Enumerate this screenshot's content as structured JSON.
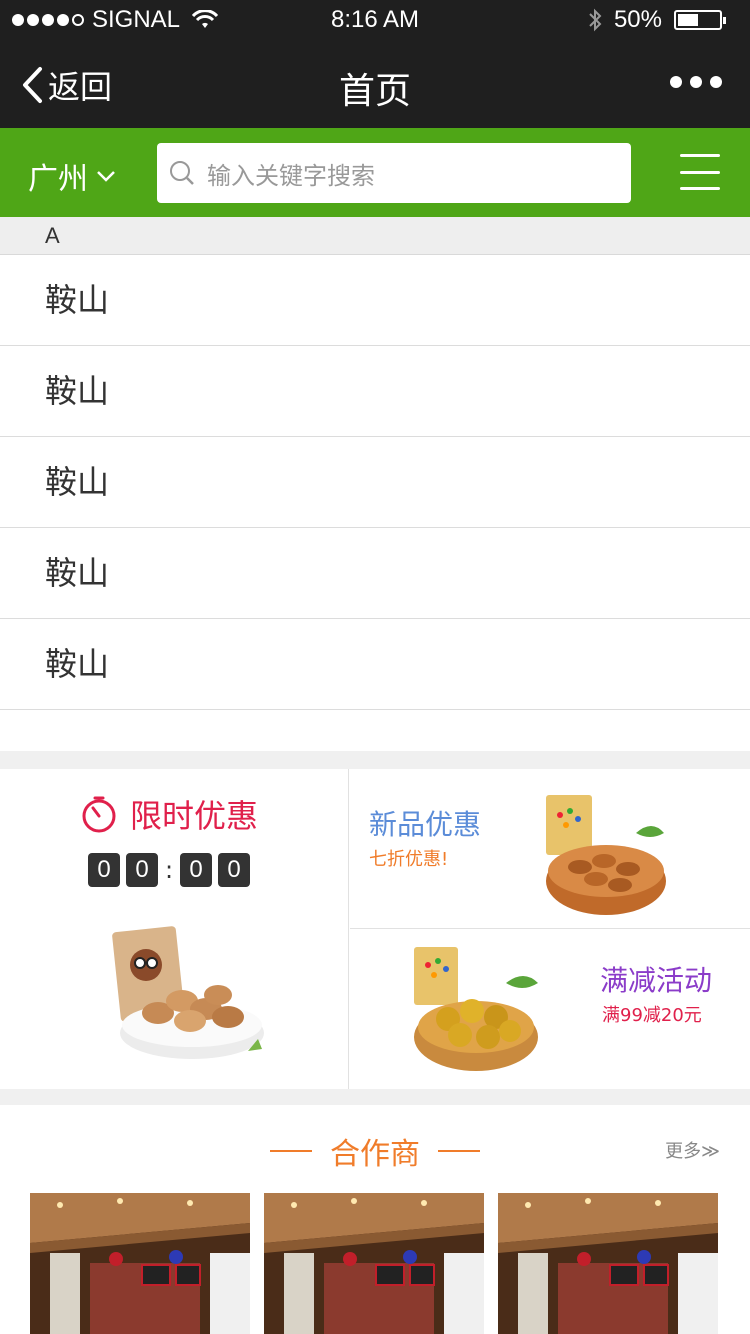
{
  "status_bar": {
    "carrier": "SIGNAL",
    "time": "8:16 AM",
    "battery": "50%",
    "battery_level": 0.5,
    "signal_bars": 4
  },
  "nav": {
    "back_label": "返回",
    "title": "首页"
  },
  "search": {
    "city": "广州",
    "placeholder": "输入关键字搜索"
  },
  "city_index": {
    "letter": "A",
    "items": [
      {
        "name": "鞍山"
      },
      {
        "name": "鞍山"
      },
      {
        "name": "鞍山"
      },
      {
        "name": "鞍山"
      },
      {
        "name": "鞍山"
      }
    ]
  },
  "promotions": {
    "limited": {
      "title": "限时优惠",
      "countdown": [
        "0",
        "0",
        "0",
        "0"
      ],
      "separator": ":"
    },
    "new_product": {
      "title": "新品优惠",
      "subtitle": "七折优惠!"
    },
    "discount": {
      "title": "满减活动",
      "subtitle": "满99减20元"
    }
  },
  "partners": {
    "title": "合作商",
    "more": "更多≫"
  },
  "colors": {
    "header_dark": "#1f1f1f",
    "brand_green": "#4fa617",
    "limited_red": "#e0204b",
    "new_blue": "#5b8cd8",
    "discount_purple": "#8b3cc9",
    "accent_orange": "#f07c2a"
  }
}
